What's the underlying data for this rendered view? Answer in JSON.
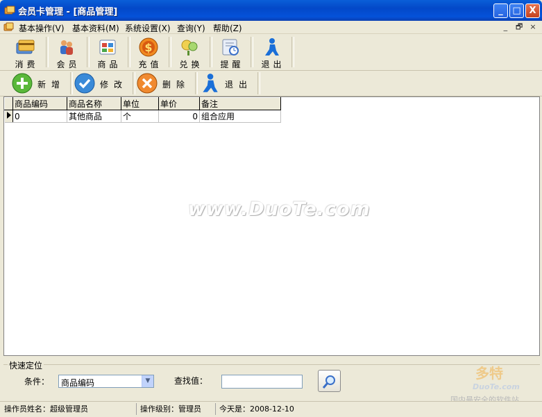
{
  "window": {
    "title": "会员卡管理 - [商品管理]",
    "minimize_glyph": "_",
    "maximize_glyph": "□",
    "close_glyph": "X"
  },
  "menu": {
    "items": [
      "基本操作(V)",
      "基本资料(M)",
      "系统设置(X)",
      "查询(Y)",
      "帮助(Z)"
    ],
    "mdi_controls": [
      "_",
      "🗗",
      "×"
    ]
  },
  "toolbar_main": [
    {
      "label": "消费",
      "icon": "card-icon"
    },
    {
      "label": "会员",
      "icon": "members-icon"
    },
    {
      "label": "商品",
      "icon": "goods-icon"
    },
    {
      "label": "充值",
      "icon": "recharge-icon"
    },
    {
      "label": "兑换",
      "icon": "exchange-icon"
    },
    {
      "label": "提醒",
      "icon": "reminder-icon"
    },
    {
      "label": "退出",
      "icon": "exit-icon"
    }
  ],
  "toolbar_actions": [
    {
      "label": "新增",
      "icon": "add-icon"
    },
    {
      "label": "修改",
      "icon": "edit-icon"
    },
    {
      "label": "删除",
      "icon": "delete-icon"
    },
    {
      "label": "退出",
      "icon": "exit-icon"
    }
  ],
  "grid": {
    "columns": [
      "商品编码",
      "商品名称",
      "单位",
      "单价",
      "备注"
    ],
    "rows": [
      [
        "0",
        "其他商品",
        "个",
        "0",
        "组合应用"
      ]
    ]
  },
  "watermark": "www.DuoTe.com",
  "quick_search": {
    "legend": "快速定位",
    "condition_label": "条件：",
    "condition_value": "商品编码",
    "find_label": "查找值：",
    "find_value": ""
  },
  "stamp": {
    "title": "多特",
    "subtitle": "DuoTe.com",
    "tagline": "国内最安全的软件站"
  },
  "status": {
    "operator": "操作员姓名：超级管理员",
    "level": "操作级别：管理员",
    "today": "今天是：2008-12-10"
  },
  "colors": {
    "titlebar": "#0348C8",
    "face": "#ECE9D8",
    "close_button": "#C5421F"
  }
}
